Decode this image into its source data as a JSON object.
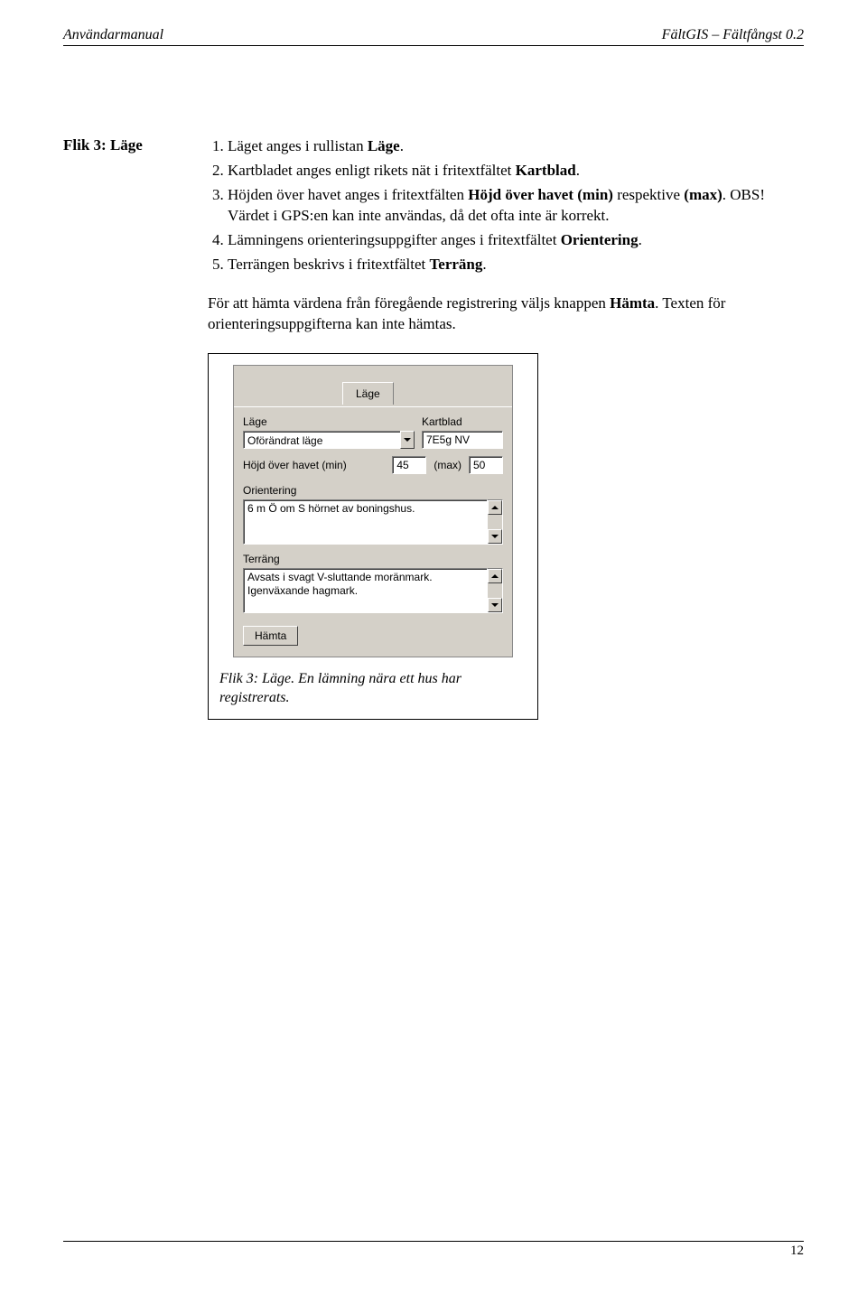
{
  "header": {
    "left": "Användarmanual",
    "right": "FältGIS – Fältfångst 0.2"
  },
  "section_heading": "Flik 3: Läge",
  "instructions": [
    {
      "pre": "Läget anges i rullistan ",
      "bold": "Läge",
      "post": "."
    },
    {
      "pre": "Kartbladet anges enligt rikets nät i fritextfältet ",
      "bold": "Kartblad",
      "post": "."
    },
    {
      "pre": "Höjden över havet anges i fritextfälten ",
      "bold": "Höjd över havet (min)",
      "post": " respektive ",
      "bold2": "(max)",
      "post2": ". OBS! Värdet i GPS:en kan inte användas, då det ofta inte är korrekt."
    },
    {
      "pre": "Lämningens orienteringsuppgifter anges i fritextfältet ",
      "bold": "Orientering",
      "post": "."
    },
    {
      "pre": "Terrängen beskrivs i fritextfältet ",
      "bold": "Terräng",
      "post": "."
    }
  ],
  "para_pre": "För att hämta värdena från föregående registrering väljs knappen ",
  "para_bold": "Hämta",
  "para_post": ". Texten för orienteringsuppgifterna kan inte hämtas.",
  "form": {
    "tab_label": "Läge",
    "lage_label": "Läge",
    "kartblad_label": "Kartblad",
    "lage_select_value": "Oförändrat läge",
    "kartblad_value": "7E5g NV",
    "hojd_label": "Höjd över havet (min)",
    "hojd_min": "45",
    "max_label": "(max)",
    "hojd_max": "50",
    "orientering_label": "Orientering",
    "orientering_value": "6 m Ö om S hörnet av boningshus.",
    "terrang_label": "Terräng",
    "terrang_value": "Avsats i svagt V-sluttande moränmark. Igenväxande hagmark.",
    "hamta_button": "Hämta"
  },
  "caption": "Flik 3: Läge. En lämning nära ett hus har registrerats.",
  "page_number": "12"
}
